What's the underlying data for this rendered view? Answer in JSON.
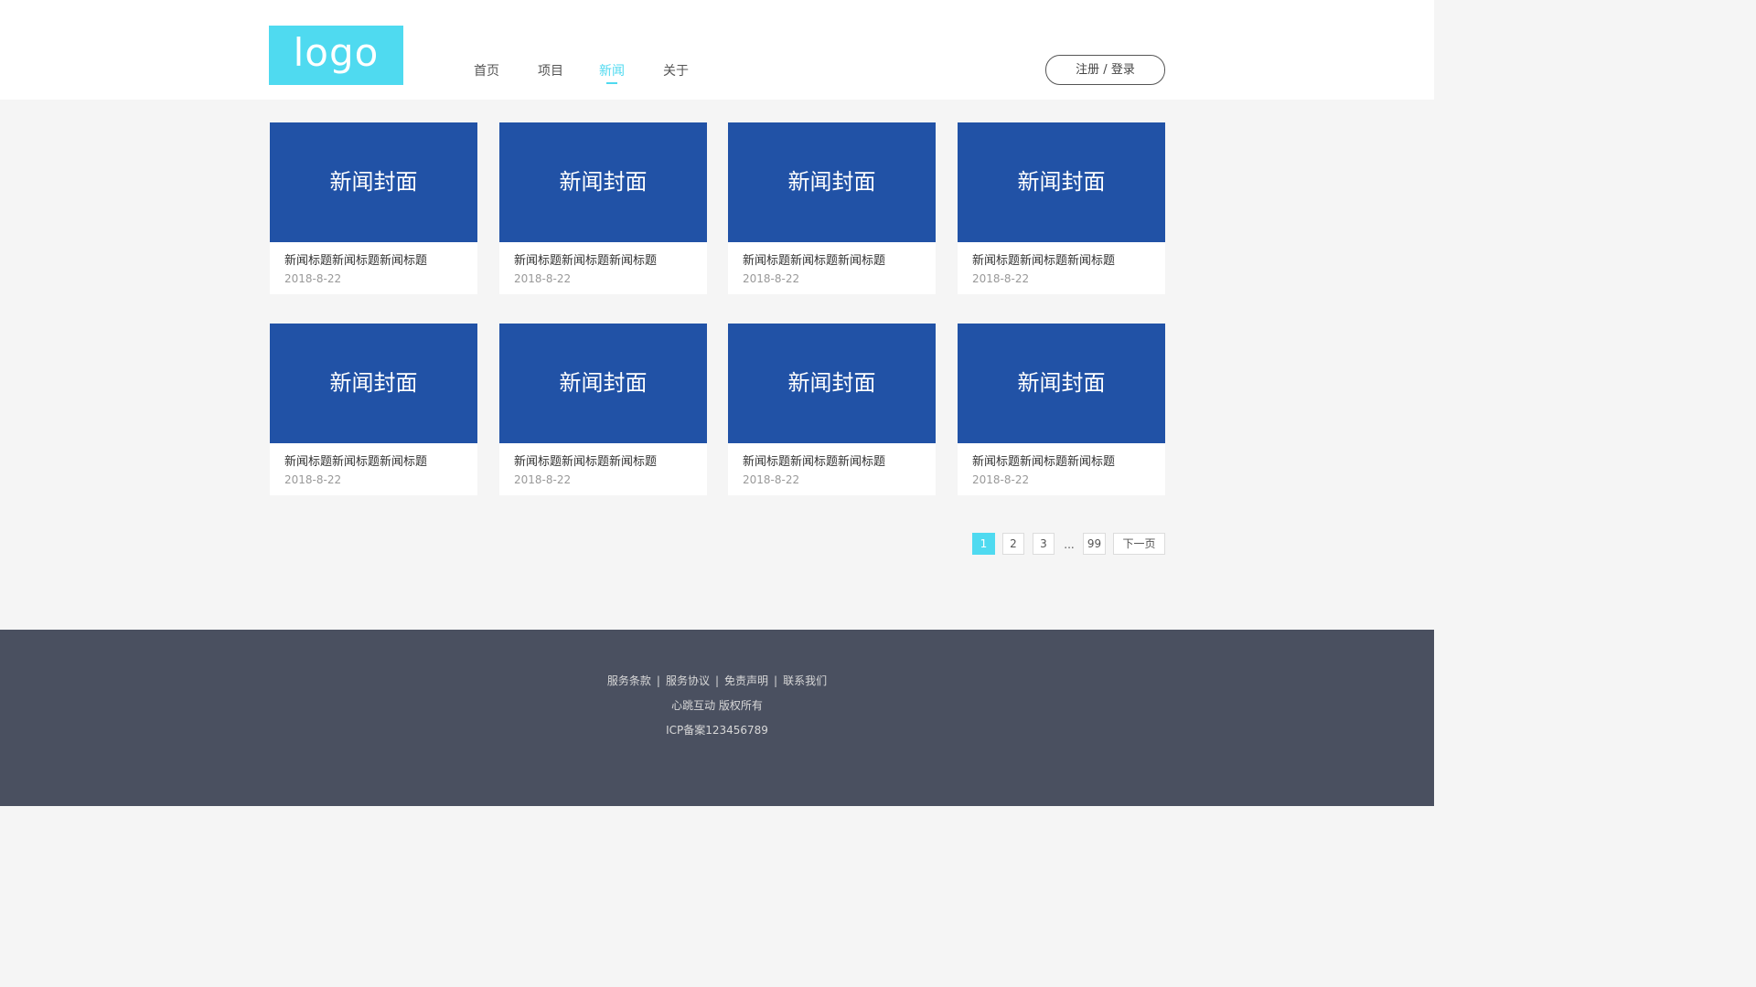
{
  "header": {
    "logo": "logo",
    "nav": [
      {
        "label": "首页"
      },
      {
        "label": "项目"
      },
      {
        "label": "新闻",
        "active": true
      },
      {
        "label": "关于"
      }
    ],
    "login_label": "注册 / 登录"
  },
  "news": [
    {
      "cover": "新闻封面",
      "title": "新闻标题新闻标题新闻标题",
      "date": "2018-8-22"
    },
    {
      "cover": "新闻封面",
      "title": "新闻标题新闻标题新闻标题",
      "date": "2018-8-22"
    },
    {
      "cover": "新闻封面",
      "title": "新闻标题新闻标题新闻标题",
      "date": "2018-8-22"
    },
    {
      "cover": "新闻封面",
      "title": "新闻标题新闻标题新闻标题",
      "date": "2018-8-22"
    },
    {
      "cover": "新闻封面",
      "title": "新闻标题新闻标题新闻标题",
      "date": "2018-8-22"
    },
    {
      "cover": "新闻封面",
      "title": "新闻标题新闻标题新闻标题",
      "date": "2018-8-22"
    },
    {
      "cover": "新闻封面",
      "title": "新闻标题新闻标题新闻标题",
      "date": "2018-8-22"
    },
    {
      "cover": "新闻封面",
      "title": "新闻标题新闻标题新闻标题",
      "date": "2018-8-22"
    }
  ],
  "pagination": {
    "pages": [
      "1",
      "2",
      "3"
    ],
    "ellipsis": "...",
    "last": "99",
    "next": "下一页",
    "current": "1"
  },
  "footer": {
    "links": [
      "服务条款",
      "服务协议",
      "免责声明",
      "联系我们"
    ],
    "separator": "|",
    "copyright": "心跳互动 版权所有",
    "icp": "ICP备案123456789"
  },
  "colors": {
    "accent": "#4fdaf0",
    "cover": "#2152a6",
    "footer_bg": "#4a5060",
    "page_bg": "#f5f5f5"
  }
}
